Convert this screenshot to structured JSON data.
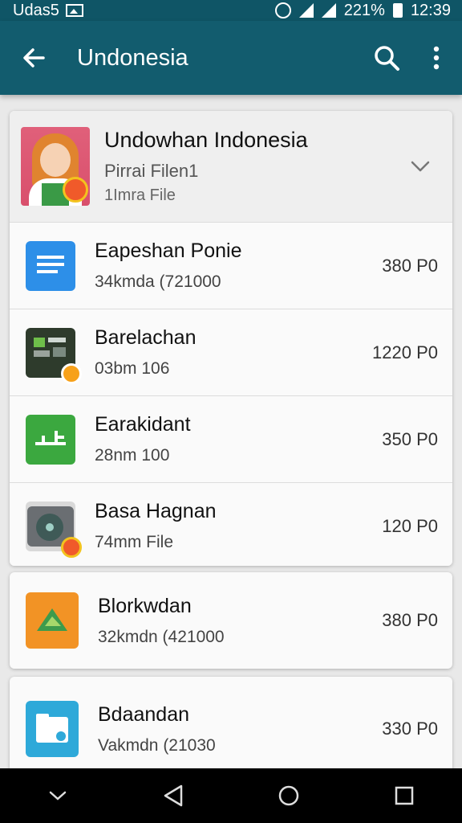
{
  "status_bar": {
    "left_text": "Udas5",
    "battery_text": "221%",
    "time": "12:39"
  },
  "app_bar": {
    "title": "Undonesia",
    "icons": [
      "back-arrow-icon",
      "search-icon",
      "more-vert-icon"
    ]
  },
  "header": {
    "title": "Undowhan Indonesia",
    "subtitle": "Pirrai Filen1",
    "meta": "1Imra File"
  },
  "items": [
    {
      "title": "Eapeshan Ponie",
      "subtitle": "34kmda (721000",
      "price": "380 P0",
      "icon": "list-doc-icon",
      "color": "#2d8fe8"
    },
    {
      "title": "Barelachan",
      "subtitle": "03bm 106",
      "price": "1220 P0",
      "icon": "panel-icon",
      "color": "#2e3b2c"
    },
    {
      "title": "Earakidant",
      "subtitle": "28nm 100",
      "price": "350 P0",
      "icon": "chart-icon",
      "color": "#3ba83f"
    },
    {
      "title": "Basa Hagnan",
      "subtitle": "74mm File",
      "price": "120 P0",
      "icon": "disc-icon",
      "color": "#5b5f63"
    }
  ],
  "cards": [
    {
      "title": "Blorkwdan",
      "subtitle": "32kmdn (421000",
      "price": "380 P0",
      "icon": "orange-app-icon",
      "color": "#f29325"
    },
    {
      "title": "Bdaandan",
      "subtitle": "Vakmdn (21030",
      "price": "330 P0",
      "icon": "folder-icon",
      "color": "#2ea9d9"
    }
  ],
  "nav": [
    "nav-down-icon",
    "nav-back-icon",
    "nav-home-icon",
    "nav-recents-icon"
  ]
}
